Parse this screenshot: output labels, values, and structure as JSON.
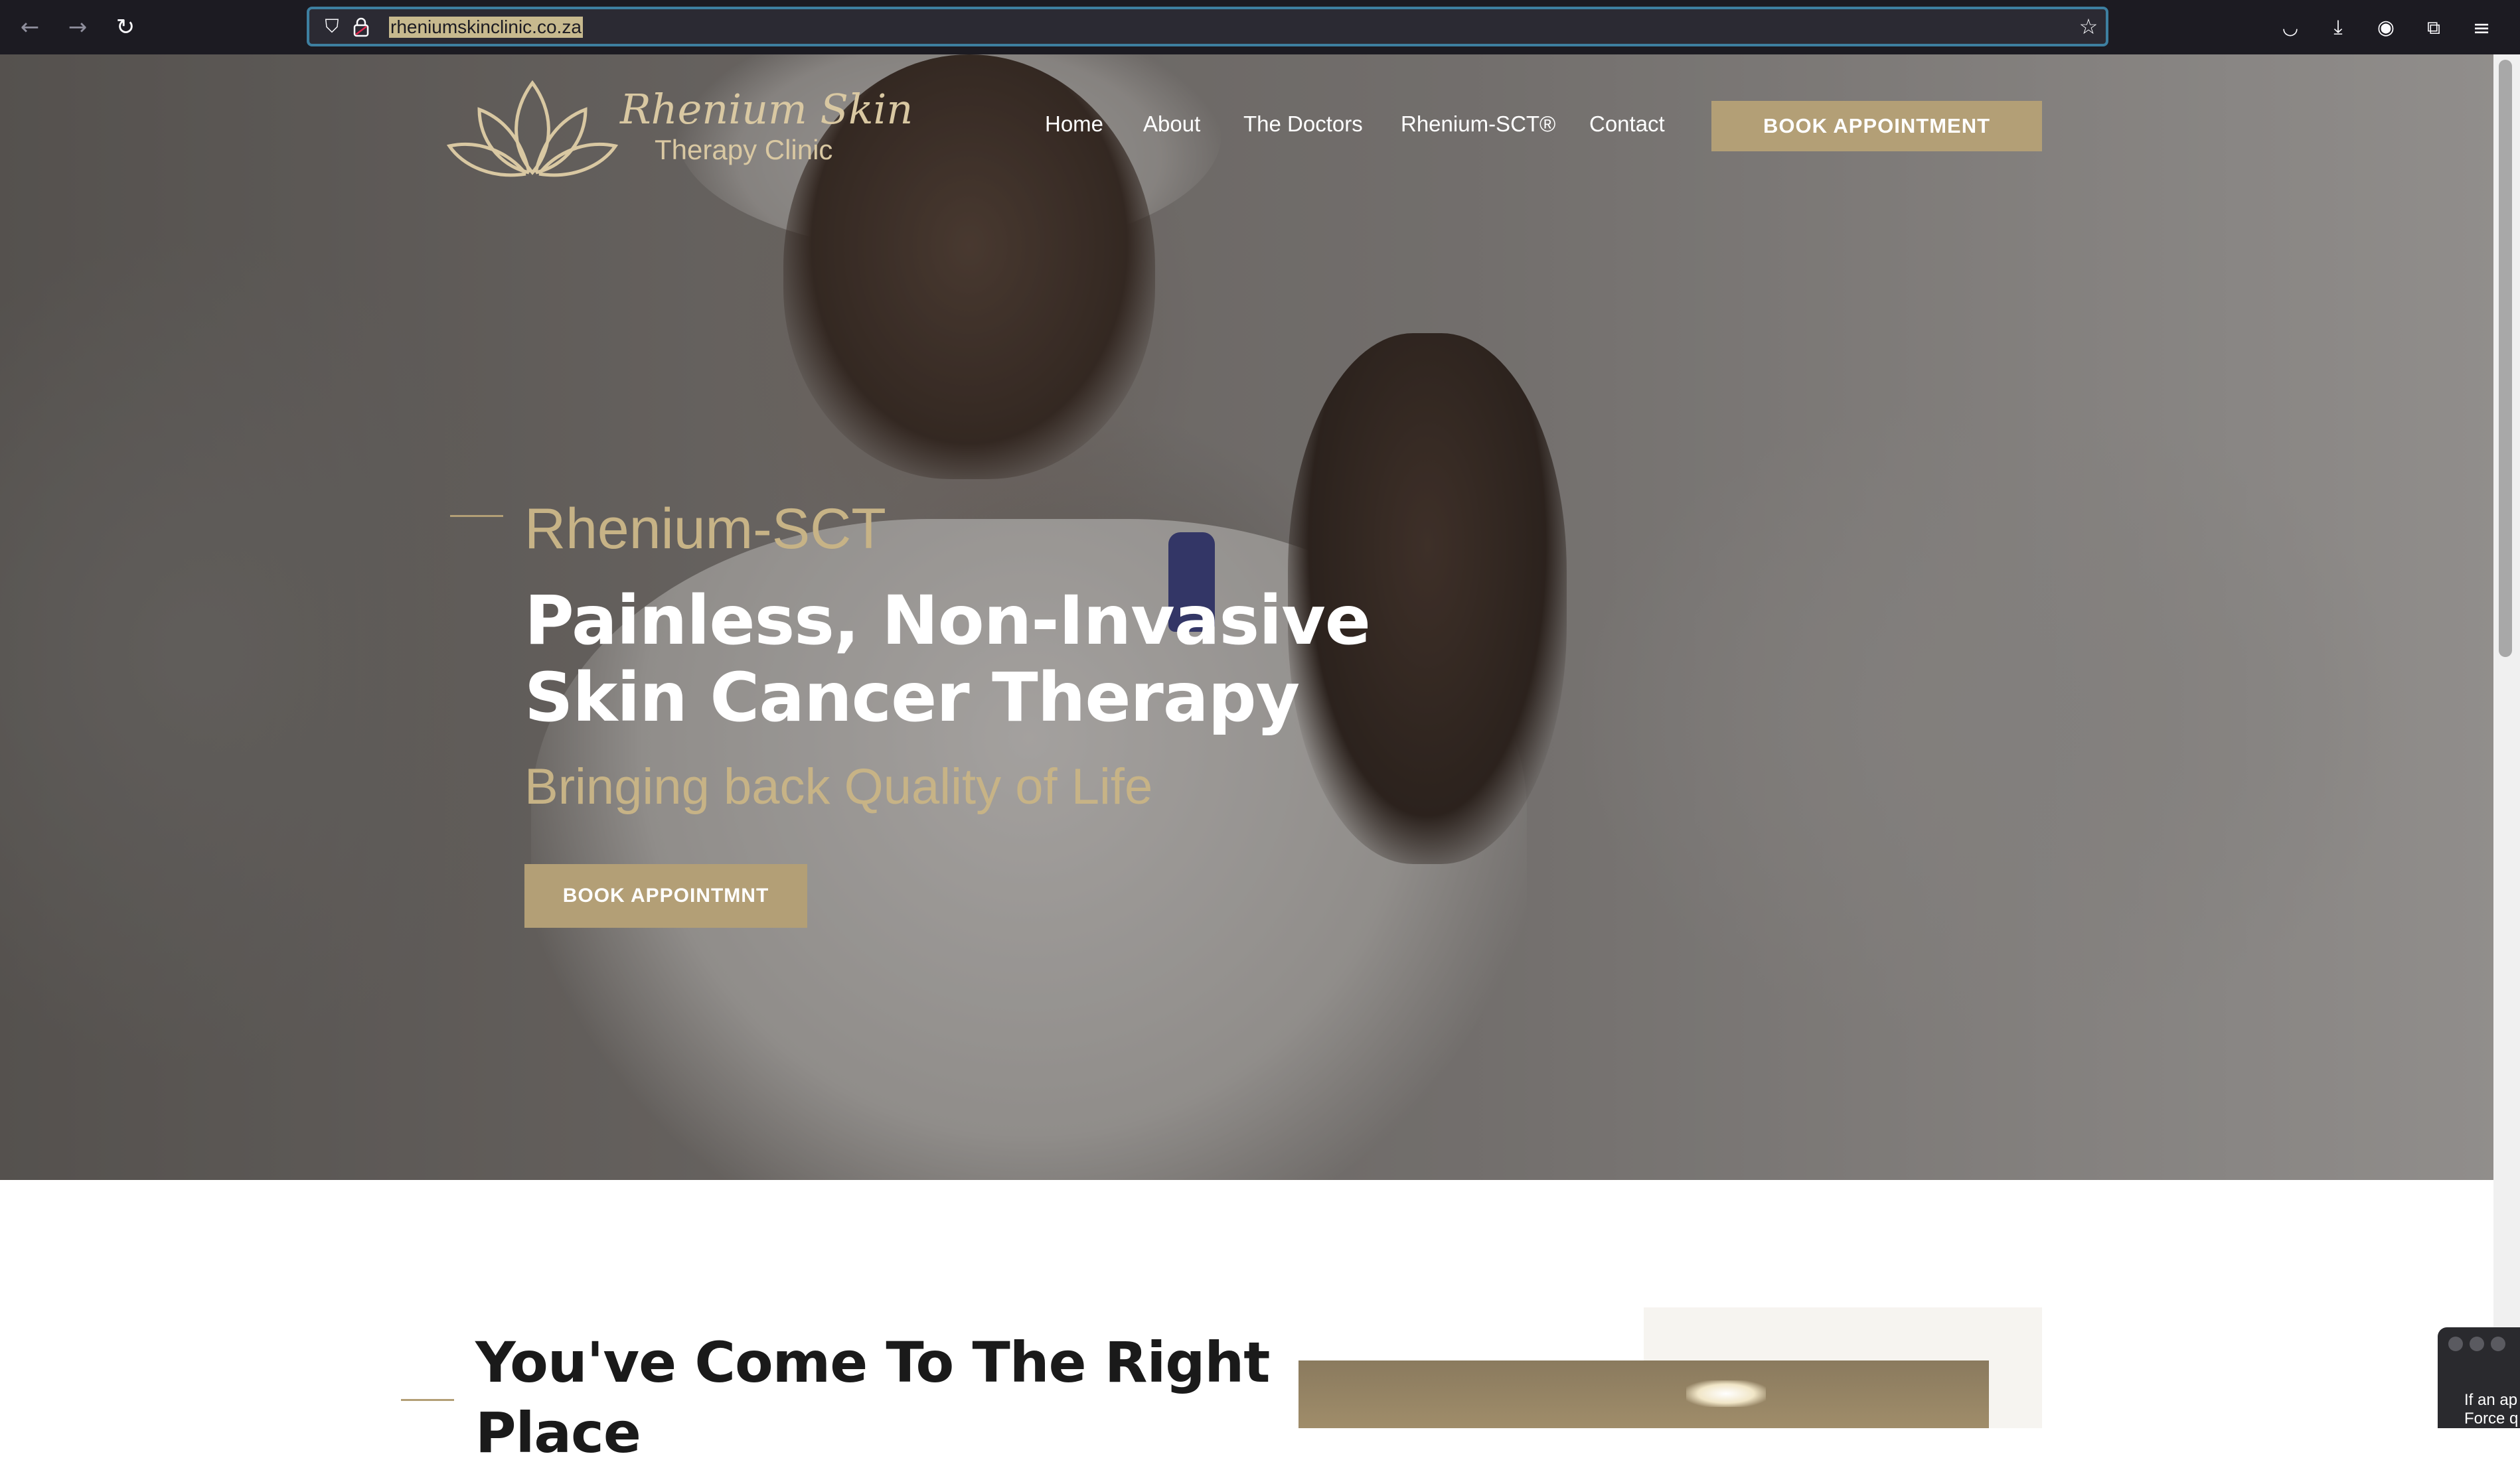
{
  "browser": {
    "url": "rheniumskinclinic.co.za",
    "icons": [
      "back-icon",
      "forward-icon",
      "reload-icon",
      "shield-icon",
      "lock-icon",
      "star-icon",
      "pocket-icon",
      "download-icon",
      "account-icon",
      "extensions-icon",
      "menu-icon"
    ]
  },
  "logo": {
    "brand": "Rhenium Skin",
    "subtitle": "Therapy Clinic"
  },
  "nav": {
    "items": [
      "Home",
      "About",
      "The Doctors",
      "Rhenium-SCT®",
      "Contact"
    ],
    "cta": "BOOK APPOINTMENT"
  },
  "hero": {
    "kicker": "Rhenium-SCT",
    "title_line1": "Painless, Non-Invasive",
    "title_line2": "Skin Cancer Therapy",
    "tagline": "Bringing back Quality of Life",
    "cta": "BOOK APPOINTMNT"
  },
  "section": {
    "title_line1": "You've Come To The Right",
    "title_line2": "Place"
  },
  "popup": {
    "line1": "If an ap",
    "line2": "Force q"
  },
  "colors": {
    "accent": "#b39f76",
    "accent_text": "#c7b386",
    "chrome_bg": "#1c1b22"
  }
}
